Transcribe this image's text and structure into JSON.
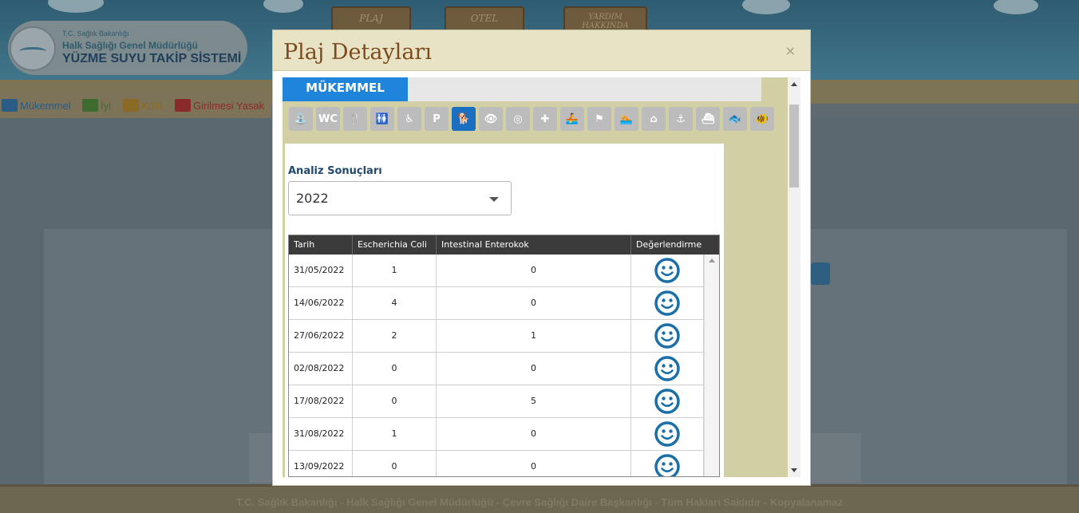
{
  "background": {
    "logo": {
      "small": "T.C. Sağlık Bakanlığı",
      "mid": "Halk Sağlığı Genel Müdürlüğü",
      "big": "YÜZME SUYU TAKİP SİSTEMİ"
    },
    "nav_signs": [
      "PLAJ",
      "OTEL",
      "YARDIM HAKKINDA"
    ],
    "legend": [
      {
        "label": "Mükemmel",
        "color": "#2a5c86"
      },
      {
        "label": "İyi",
        "color": "#3f6b31"
      },
      {
        "label": "Kötü",
        "color": "#8a6a24"
      },
      {
        "label": "Girilmesi Yasak",
        "color": "#8a2a2a"
      }
    ],
    "footer": "T.C. Sağlık Bakanlığı - Halk Sağlığı Genel Müdürlüğü - Çevre Sağlığı Daire Başkanlığı - Tüm Hakları Saklıdır - Kopyalanamaz"
  },
  "modal": {
    "title": "Plaj Detayları",
    "close": "×",
    "status": "MÜKEMMEL",
    "facilities": [
      {
        "name": "shower-icon",
        "glyph": "⛲",
        "active": false
      },
      {
        "name": "wc-icon",
        "glyph": "WC",
        "active": false
      },
      {
        "name": "restaurant-icon",
        "glyph": "🍴",
        "active": false
      },
      {
        "name": "changing-room-icon",
        "glyph": "🚻",
        "active": false
      },
      {
        "name": "wheelchair-icon",
        "glyph": "♿",
        "active": false
      },
      {
        "name": "parking-icon",
        "glyph": "P",
        "active": false
      },
      {
        "name": "pet-friendly-icon",
        "glyph": "🐕",
        "active": true
      },
      {
        "name": "binoculars-icon",
        "glyph": "👁",
        "active": false
      },
      {
        "name": "lifebuoy-icon",
        "glyph": "◎",
        "active": false
      },
      {
        "name": "first-aid-icon",
        "glyph": "✚",
        "active": false
      },
      {
        "name": "rowing-icon",
        "glyph": "🚣",
        "active": false
      },
      {
        "name": "flag-icon",
        "glyph": "⚑",
        "active": false
      },
      {
        "name": "swimming-icon",
        "glyph": "🏊",
        "active": false
      },
      {
        "name": "hut-icon",
        "glyph": "⌂",
        "active": false
      },
      {
        "name": "anchor-icon",
        "glyph": "⚓",
        "active": false
      },
      {
        "name": "boat-icon",
        "glyph": "⛴",
        "active": false
      },
      {
        "name": "fishing-icon",
        "glyph": "🐟",
        "active": false
      },
      {
        "name": "aquarium-icon",
        "glyph": "🐠",
        "active": false
      }
    ],
    "analysis_label": "Analiz Sonuçları",
    "year": "2022",
    "table": {
      "headers": [
        "Tarih",
        "Escherichia Coli",
        "Intestinal Enterokok",
        "Değerlendirme"
      ],
      "rows": [
        {
          "date": "31/05/2022",
          "ecoli": "1",
          "entero": "0",
          "rating": "smiley-icon"
        },
        {
          "date": "14/06/2022",
          "ecoli": "4",
          "entero": "0",
          "rating": "smiley-icon"
        },
        {
          "date": "27/06/2022",
          "ecoli": "2",
          "entero": "1",
          "rating": "smiley-icon"
        },
        {
          "date": "02/08/2022",
          "ecoli": "0",
          "entero": "0",
          "rating": "smiley-icon"
        },
        {
          "date": "17/08/2022",
          "ecoli": "0",
          "entero": "5",
          "rating": "smiley-icon"
        },
        {
          "date": "31/08/2022",
          "ecoli": "1",
          "entero": "0",
          "rating": "smiley-icon"
        },
        {
          "date": "13/09/2022",
          "ecoli": "0",
          "entero": "0",
          "rating": "smiley-icon"
        }
      ]
    },
    "colors": {
      "accent": "#1e84dc",
      "rating_blue": "#1b6fa8",
      "title_brown": "#7c4c20"
    }
  }
}
